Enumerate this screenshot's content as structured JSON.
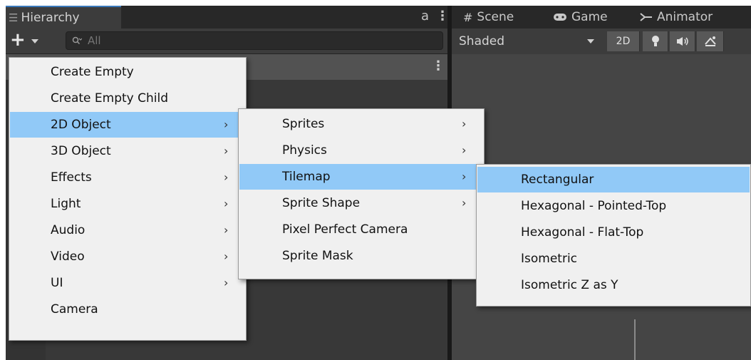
{
  "hierarchy": {
    "tab_label": "Hierarchy",
    "lock_glyph": "a",
    "more_glyph": "⋮",
    "add_glyph": "+",
    "search_placeholder": "All"
  },
  "scene": {
    "tabs": [
      {
        "label": "Scene",
        "icon": "#"
      },
      {
        "label": "Game",
        "icon": "gamepad-icon"
      },
      {
        "label": "Animator",
        "icon": "animator-icon"
      }
    ],
    "shading_mode": "Shaded",
    "mode_2d_label": "2D"
  },
  "menu_main": {
    "items": [
      {
        "label": "Create Empty",
        "submenu": false
      },
      {
        "label": "Create Empty Child",
        "submenu": false
      },
      {
        "label": "2D Object",
        "submenu": true,
        "highlighted": true
      },
      {
        "label": "3D Object",
        "submenu": true
      },
      {
        "label": "Effects",
        "submenu": true
      },
      {
        "label": "Light",
        "submenu": true
      },
      {
        "label": "Audio",
        "submenu": true
      },
      {
        "label": "Video",
        "submenu": true
      },
      {
        "label": "UI",
        "submenu": true
      },
      {
        "label": "Camera",
        "submenu": false
      }
    ]
  },
  "menu_2d": {
    "items": [
      {
        "label": "Sprites",
        "submenu": true
      },
      {
        "label": "Physics",
        "submenu": true
      },
      {
        "label": "Tilemap",
        "submenu": true,
        "highlighted": true
      },
      {
        "label": "Sprite Shape",
        "submenu": true
      },
      {
        "label": "Pixel Perfect Camera",
        "submenu": false
      },
      {
        "label": "Sprite Mask",
        "submenu": false
      }
    ]
  },
  "menu_tilemap": {
    "items": [
      {
        "label": "Rectangular",
        "highlighted": true
      },
      {
        "label": "Hexagonal - Pointed-Top"
      },
      {
        "label": "Hexagonal - Flat-Top"
      },
      {
        "label": "Isometric"
      },
      {
        "label": "Isometric Z as Y"
      }
    ]
  },
  "colors": {
    "highlight": "#91c9f7",
    "menu_bg": "#f0f0f0",
    "panel_dark": "#282828",
    "tab_accent": "#3a79bb"
  }
}
